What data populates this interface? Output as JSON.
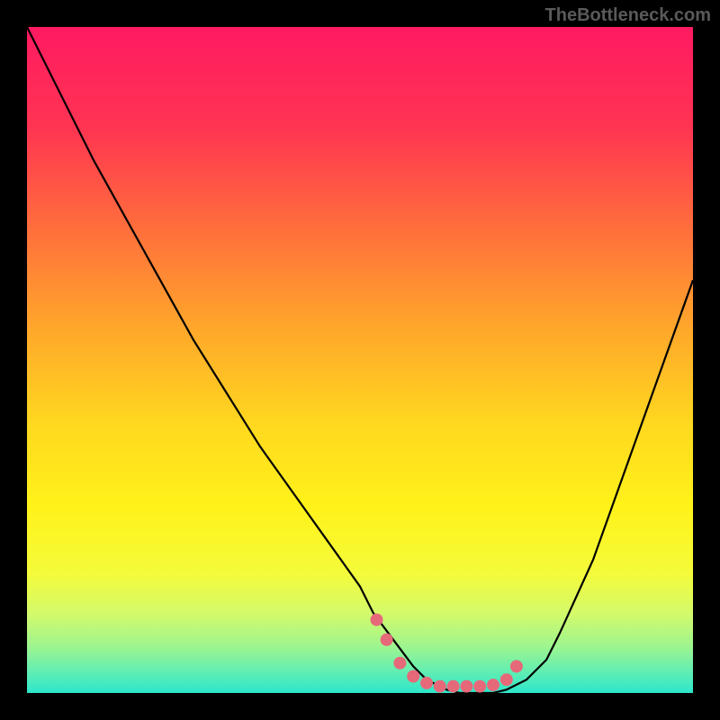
{
  "watermark": "TheBottleneck.com",
  "chart_data": {
    "type": "line",
    "title": "",
    "xlabel": "",
    "ylabel": "",
    "xlim": [
      0,
      100
    ],
    "ylim": [
      0,
      100
    ],
    "series": [
      {
        "name": "curve",
        "x": [
          0,
          5,
          10,
          15,
          20,
          25,
          30,
          35,
          40,
          45,
          50,
          52,
          55,
          58,
          60,
          63,
          65,
          68,
          70,
          72,
          75,
          78,
          80,
          85,
          90,
          95,
          100
        ],
        "y": [
          100,
          90,
          80,
          71,
          62,
          53,
          45,
          37,
          30,
          23,
          16,
          12,
          8,
          4,
          2,
          0.5,
          0,
          0,
          0,
          0.5,
          2,
          5,
          9,
          20,
          34,
          48,
          62
        ]
      }
    ],
    "markers": {
      "name": "pink-dots",
      "x": [
        52.5,
        54,
        56,
        58,
        60,
        62,
        64,
        66,
        68,
        70,
        72,
        73.5
      ],
      "y": [
        11,
        8,
        4.5,
        2.5,
        1.5,
        1,
        1,
        1,
        1,
        1.2,
        2,
        4
      ],
      "color": "#e6697a"
    },
    "gradient_stops": [
      {
        "offset": 0.0,
        "color": "#ff1a62"
      },
      {
        "offset": 0.15,
        "color": "#ff3452"
      },
      {
        "offset": 0.3,
        "color": "#ff6d3c"
      },
      {
        "offset": 0.45,
        "color": "#ffa62b"
      },
      {
        "offset": 0.6,
        "color": "#ffd91f"
      },
      {
        "offset": 0.72,
        "color": "#fff21a"
      },
      {
        "offset": 0.82,
        "color": "#f4fb3a"
      },
      {
        "offset": 0.88,
        "color": "#d4fa6a"
      },
      {
        "offset": 0.93,
        "color": "#9ef58f"
      },
      {
        "offset": 0.97,
        "color": "#5eedb4"
      },
      {
        "offset": 1.0,
        "color": "#2de6cb"
      }
    ]
  }
}
